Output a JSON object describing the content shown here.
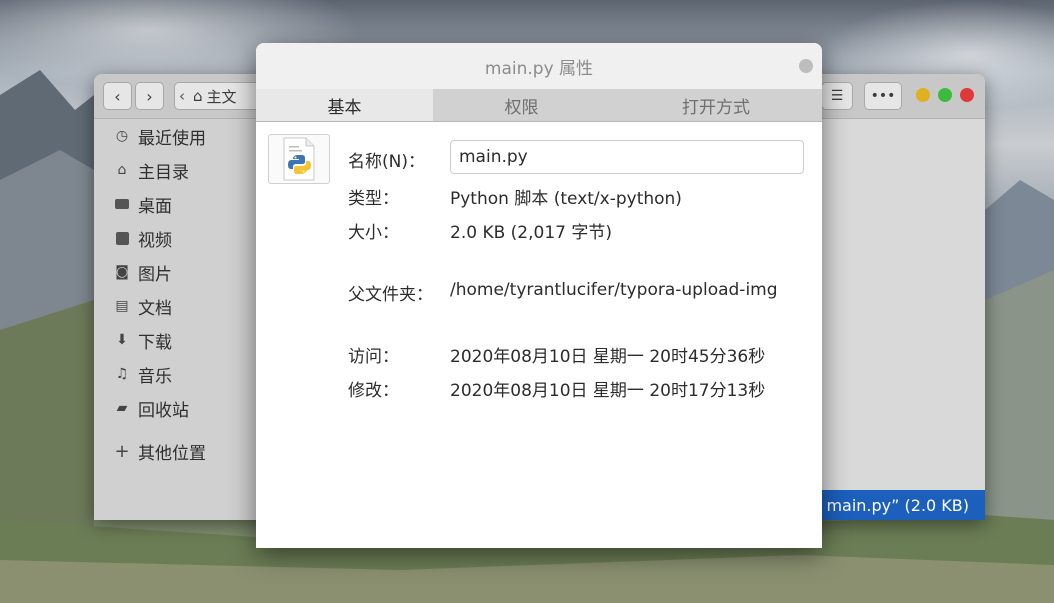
{
  "files_window": {
    "path_label": "主文",
    "sidebar": [
      {
        "label": "最近使用",
        "icon": "clock-icon"
      },
      {
        "label": "主目录",
        "icon": "home-icon"
      },
      {
        "label": "桌面",
        "icon": "desktop-icon"
      },
      {
        "label": "视频",
        "icon": "video-icon"
      },
      {
        "label": "图片",
        "icon": "camera-icon"
      },
      {
        "label": "文档",
        "icon": "document-icon"
      },
      {
        "label": "下载",
        "icon": "download-icon"
      },
      {
        "label": "音乐",
        "icon": "music-icon"
      },
      {
        "label": "回收站",
        "icon": "trash-icon"
      },
      {
        "label": "其他位置",
        "icon": "plus-icon"
      }
    ],
    "status_text": "main.py” (2.0 KB)",
    "status_color": "#1c5fbd",
    "window_buttons": {
      "minimize_color": "#e0b020",
      "maximize_color": "#3dbb3d",
      "close_color": "#e0393c"
    }
  },
  "dialog": {
    "title": "main.py 属性",
    "tabs": [
      "基本",
      "权限",
      "打开方式"
    ],
    "active_tab": "基本",
    "file_icon": "python-file-icon",
    "fields": {
      "name_label": "名称(N)：",
      "name_value": "main.py",
      "type_label": "类型：",
      "type_value": "Python 脚本 (text/x-python)",
      "size_label": "大小：",
      "size_value": "2.0 KB (2,017 字节)",
      "parent_label": "父文件夹：",
      "parent_value": "/home/tyrantlucifer/typora-upload-img",
      "accessed_label": "访问：",
      "accessed_value": "2020年08月10日 星期一 20时45分36秒",
      "modified_label": "修改：",
      "modified_value": "2020年08月10日 星期一 20时17分13秒"
    }
  }
}
